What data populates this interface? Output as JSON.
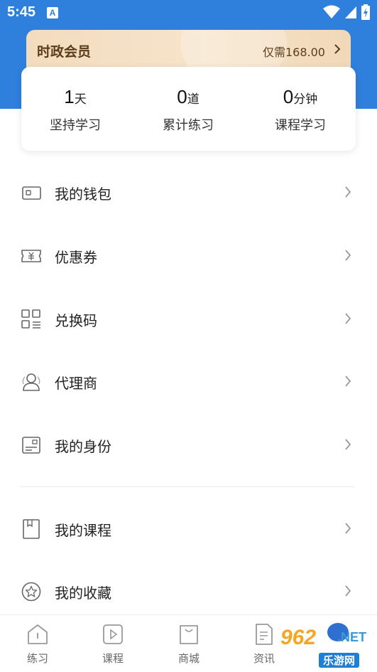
{
  "status_bar": {
    "time": "5:45",
    "notif_badge": "A"
  },
  "vip": {
    "title": "时政会员",
    "price_text": "仅需168.00"
  },
  "stats": [
    {
      "value": "1",
      "unit": "天",
      "label": "坚持学习"
    },
    {
      "value": "0",
      "unit": "道",
      "label": "累计练习"
    },
    {
      "value": "0",
      "unit": "分钟",
      "label": "课程学习"
    }
  ],
  "menu": [
    {
      "label": "我的钱包",
      "icon": "wallet-icon"
    },
    {
      "label": "优惠券",
      "icon": "coupon-icon"
    },
    {
      "label": "兑换码",
      "icon": "redeem-code-icon"
    },
    {
      "label": "代理商",
      "icon": "agent-icon"
    },
    {
      "label": "我的身份",
      "icon": "id-card-icon"
    },
    {
      "label": "我的课程",
      "icon": "course-book-icon"
    },
    {
      "label": "我的收藏",
      "icon": "star-icon"
    }
  ],
  "tabs": [
    {
      "label": "练习",
      "icon": "practice-icon"
    },
    {
      "label": "课程",
      "icon": "video-course-icon"
    },
    {
      "label": "商城",
      "icon": "shopping-bag-icon"
    },
    {
      "label": "资讯",
      "icon": "news-icon"
    }
  ],
  "watermark": {
    "number": "962",
    "domain": ".NET",
    "name": "乐游网"
  },
  "colors": {
    "header_blue": "#2f7fdc",
    "vip_gold": "#f3dcbe",
    "vip_text": "#5b3d1b"
  }
}
